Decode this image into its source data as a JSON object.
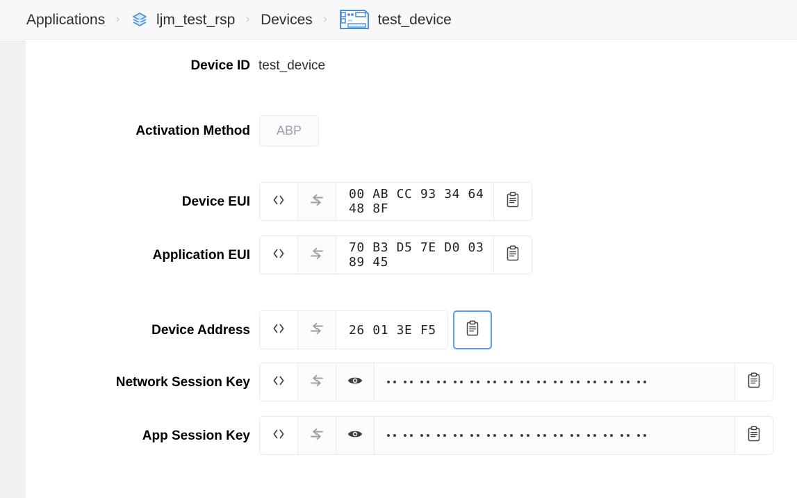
{
  "breadcrumb": {
    "items": [
      {
        "label": "Applications",
        "icon": null
      },
      {
        "label": "ljm_test_rsp",
        "icon": "layers-icon"
      },
      {
        "label": "Devices",
        "icon": null
      },
      {
        "label": "test_device",
        "icon": "device-board-icon"
      }
    ],
    "separator": "›"
  },
  "form": {
    "device_id": {
      "label": "Device ID",
      "value": "test_device"
    },
    "activation_method": {
      "label": "Activation Method",
      "value": "ABP"
    },
    "device_eui": {
      "label": "Device EUI",
      "value": "00 AB CC 93 34 64 48 8F",
      "code_icon": "code-brackets-icon",
      "swap_icon": "swap-arrows-icon",
      "copy_icon": "clipboard-copy-icon"
    },
    "application_eui": {
      "label": "Application EUI",
      "value": "70 B3 D5 7E D0 03 89 45",
      "code_icon": "code-brackets-icon",
      "swap_icon": "swap-arrows-icon",
      "copy_icon": "clipboard-copy-icon"
    },
    "device_address": {
      "label": "Device Address",
      "value": "26 01 3E F5",
      "code_icon": "code-brackets-icon",
      "swap_icon": "swap-arrows-icon",
      "copy_icon": "clipboard-copy-icon",
      "copy_focused": true
    },
    "network_session_key": {
      "label": "Network Session Key",
      "value_masked": true,
      "masked_pairs": 16,
      "code_icon": "code-brackets-icon",
      "swap_icon": "swap-arrows-icon",
      "reveal_icon": "eye-icon",
      "copy_icon": "clipboard-copy-icon"
    },
    "app_session_key": {
      "label": "App Session Key",
      "value_masked": true,
      "masked_pairs": 16,
      "code_icon": "code-brackets-icon",
      "swap_icon": "swap-arrows-icon",
      "reveal_icon": "eye-icon",
      "copy_icon": "clipboard-copy-icon"
    }
  },
  "colors": {
    "accent": "#5b9bec",
    "icon_blue": "#4a90d9",
    "header_bg": "#f8f8f9",
    "rail_bg": "#f1f1f1",
    "border": "#e8eaec",
    "text": "#2b2f33",
    "muted": "#9aa0a6"
  }
}
